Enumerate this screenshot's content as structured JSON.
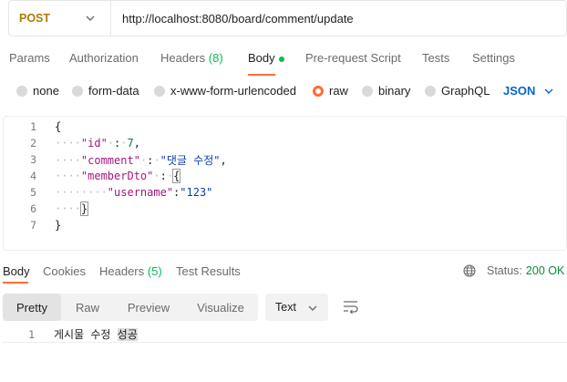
{
  "request": {
    "method": "POST",
    "url": "http://localhost:8080/board/comment/update"
  },
  "request_tabs": [
    {
      "label": "Params"
    },
    {
      "label": "Authorization"
    },
    {
      "label": "Headers",
      "count": "(8)"
    },
    {
      "label": "Body"
    },
    {
      "label": "Pre-request Script"
    },
    {
      "label": "Tests"
    },
    {
      "label": "Settings"
    }
  ],
  "body_types": [
    "none",
    "form-data",
    "x-www-form-urlencoded",
    "raw",
    "binary",
    "GraphQL"
  ],
  "body_type_selected": "raw",
  "language": "JSON",
  "editor": {
    "line_numbers": [
      "1",
      "2",
      "3",
      "4",
      "5",
      "6",
      "7"
    ],
    "open_brace": "{",
    "id_key": "\"id\"",
    "id_value": "7",
    "comment_key": "\"comment\"",
    "comment_value": "\"댓글 수정\"",
    "member_key": "\"memberDto\"",
    "username_key": "\"username\"",
    "username_value": "\"123\"",
    "close_inner": "}",
    "close_outer": "}"
  },
  "response_tabs": [
    {
      "label": "Body"
    },
    {
      "label": "Cookies"
    },
    {
      "label": "Headers",
      "count": "(5)"
    },
    {
      "label": "Test Results"
    }
  ],
  "status": {
    "label": "Status:",
    "value": "200 OK"
  },
  "view_modes": [
    "Pretty",
    "Raw",
    "Preview",
    "Visualize"
  ],
  "view_mode_selected": "Pretty",
  "format": "Text",
  "response_body": {
    "line_number": "1",
    "text_prefix": "게시물 수정 ",
    "text_highlight": "성공"
  },
  "colors": {
    "accent": "#ff6c37",
    "method": "#ad7a03",
    "status_ok": "#0a8b3a",
    "link": "#0265d2"
  }
}
